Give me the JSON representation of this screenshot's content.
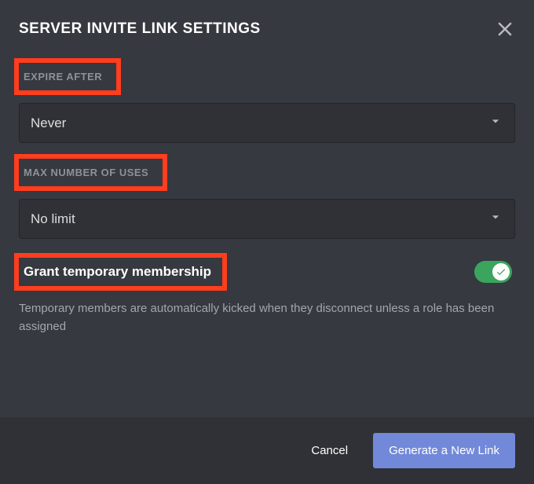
{
  "title": "SERVER INVITE LINK SETTINGS",
  "sections": {
    "expire": {
      "label": "EXPIRE AFTER",
      "value": "Never"
    },
    "maxUses": {
      "label": "MAX NUMBER OF USES",
      "value": "No limit"
    },
    "temp": {
      "label": "Grant temporary membership",
      "help": "Temporary members are automatically kicked when they disconnect unless a role has been assigned",
      "enabled": true
    }
  },
  "footer": {
    "cancel": "Cancel",
    "generate": "Generate a New Link"
  }
}
